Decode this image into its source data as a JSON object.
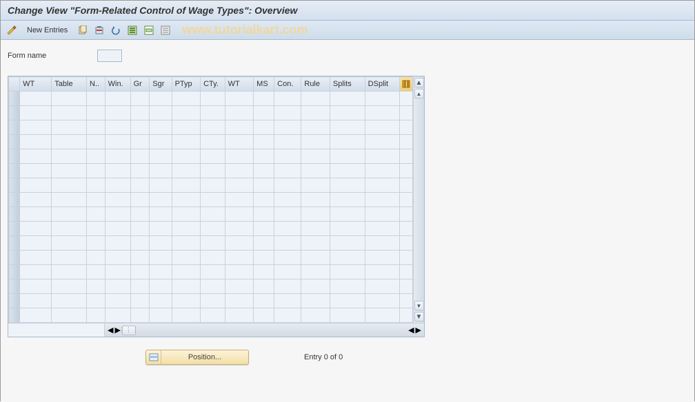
{
  "title": "Change View \"Form-Related Control of Wage Types\": Overview",
  "watermark": "www.tutorialkart.com",
  "toolbar": {
    "new_entries": "New Entries"
  },
  "form": {
    "name_label": "Form name",
    "name_value": ""
  },
  "table": {
    "columns": [
      "WT",
      "Table",
      "N..",
      "Win.",
      "Gr",
      "Sgr",
      "PTyp",
      "CTy.",
      "WT",
      "MS",
      "Con.",
      "Rule",
      "Splits",
      "DSplit"
    ],
    "row_count": 16
  },
  "footer": {
    "position_btn": "Position...",
    "entry_text": "Entry 0 of 0"
  }
}
